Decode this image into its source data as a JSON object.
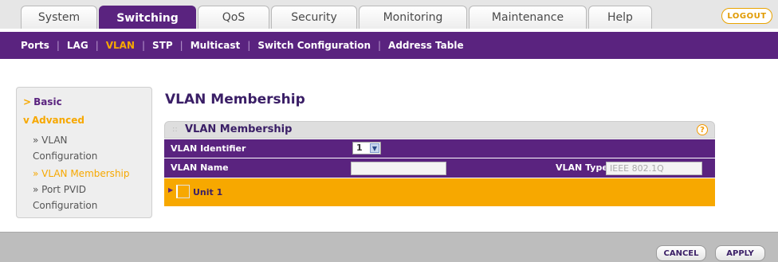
{
  "tabs": [
    {
      "label": "System",
      "active": false
    },
    {
      "label": "Switching",
      "active": true
    },
    {
      "label": "QoS",
      "active": false
    },
    {
      "label": "Security",
      "active": false
    },
    {
      "label": "Monitoring",
      "active": false
    },
    {
      "label": "Maintenance",
      "active": false
    },
    {
      "label": "Help",
      "active": false
    }
  ],
  "logout_label": "LOGOUT",
  "submenu": [
    "Ports",
    "LAG",
    "VLAN",
    "STP",
    "Multicast",
    "Switch Configuration",
    "Address Table"
  ],
  "submenu_active": "VLAN",
  "leftnav": {
    "basic": "Basic",
    "advanced": "Advanced",
    "items": [
      {
        "line1": "» VLAN",
        "line2": "Configuration"
      },
      {
        "line1": "» VLAN Membership",
        "line2": ""
      },
      {
        "line1": "» Port PVID",
        "line2": "Configuration"
      }
    ]
  },
  "page_title": "VLAN Membership",
  "panel": {
    "title": "VLAN Membership",
    "help_glyph": "?",
    "vlan_identifier_label": "VLAN Identifier",
    "vlan_identifier_value": "1",
    "vlan_name_label": "VLAN Name",
    "vlan_name_value": "",
    "vlan_type_label": "VLAN Type",
    "vlan_type_value": "IEEE 802.1Q",
    "unit_label": "Unit 1"
  },
  "buttons": {
    "cancel": "CANCEL",
    "apply": "APPLY"
  },
  "colors": {
    "purple": "#5a237f",
    "orange": "#f7a800"
  }
}
